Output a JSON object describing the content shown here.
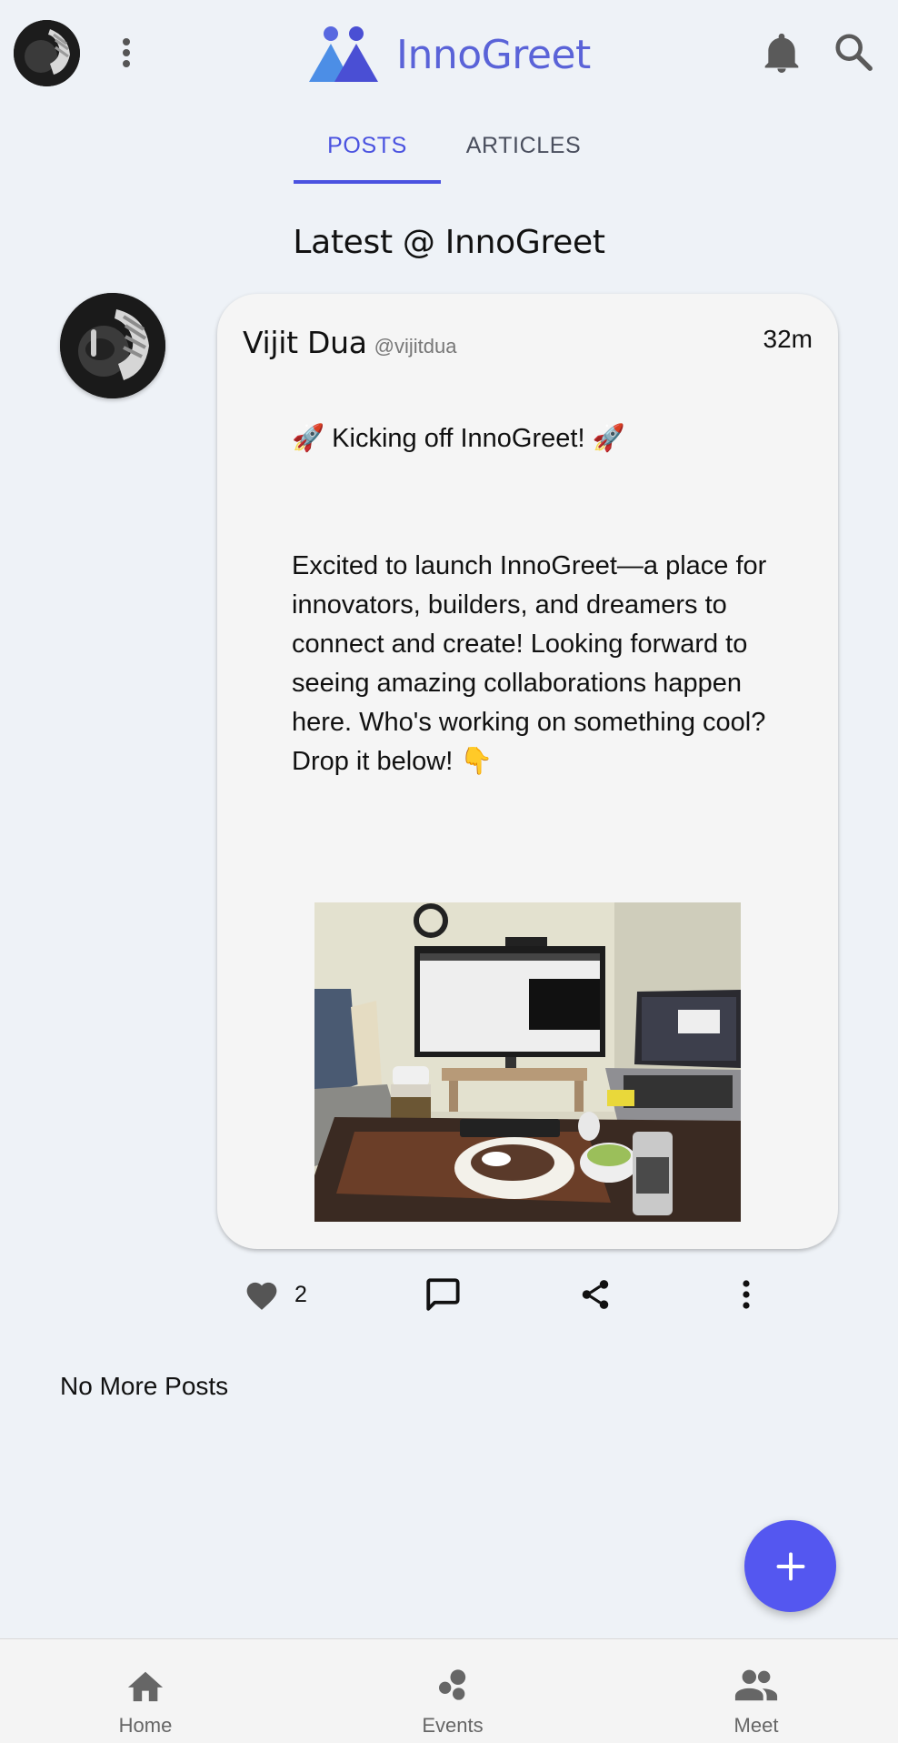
{
  "app": {
    "name": "InnoGreet",
    "brand_color": "#5a63d8",
    "accent_color": "#4a52e0"
  },
  "header": {
    "profile_icon": "user-avatar",
    "menu_icon": "more-vertical-icon",
    "notifications_icon": "bell-icon",
    "search_icon": "search-icon"
  },
  "tabs": [
    {
      "label": "POSTS",
      "active": true
    },
    {
      "label": "ARTICLES",
      "active": false
    }
  ],
  "feed": {
    "title": "Latest @ InnoGreet",
    "end_text": "No More Posts"
  },
  "post": {
    "author_name": "Vijit Dua",
    "author_handle": "@vijitdua",
    "time_ago": "32m",
    "title": "🚀 Kicking off InnoGreet! 🚀",
    "body": "Excited to launch InnoGreet—a place for innovators, builders, and dreamers to connect and create! Looking forward to seeing amazing collaborations happen here. Who's working on something cool? Drop it below! 👇",
    "like_count": "2",
    "image_icon": "desk-setup-photo"
  },
  "fab": {
    "icon": "plus-icon"
  },
  "bottom_nav": [
    {
      "label": "Home",
      "icon": "home-icon"
    },
    {
      "label": "Events",
      "icon": "events-icon"
    },
    {
      "label": "Meet",
      "icon": "people-icon"
    }
  ]
}
